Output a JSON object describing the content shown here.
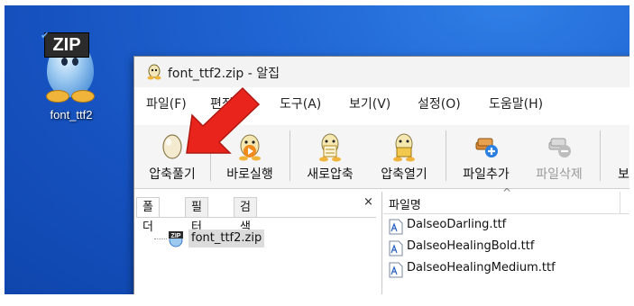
{
  "desktop": {
    "icon_badge": "ZIP",
    "icon_label": "font_ttf2"
  },
  "window": {
    "title": "font_ttf2.zip - 알집",
    "menu": [
      "파일(F)",
      "편집(E)",
      "도구(A)",
      "보기(V)",
      "설정(O)",
      "도움말(H)"
    ],
    "toolbar": [
      {
        "label": "압축풀기",
        "icon": "egg-icon",
        "enabled": true
      },
      {
        "label": "바로실행",
        "icon": "play-icon",
        "enabled": true
      },
      {
        "label": "새로압축",
        "icon": "new-archive-icon",
        "enabled": true
      },
      {
        "label": "압축열기",
        "icon": "open-archive-icon",
        "enabled": true
      },
      {
        "label": "파일추가",
        "icon": "add-file-icon",
        "enabled": true
      },
      {
        "label": "파일삭제",
        "icon": "delete-file-icon",
        "enabled": false
      },
      {
        "label": "보",
        "icon": "",
        "enabled": true
      }
    ],
    "left_tabs": [
      "폴더",
      "필터",
      "검색"
    ],
    "close_glyph": "×",
    "tree_item": "font_ttf2.zip",
    "column_header": "파일명",
    "sort_glyph": "^",
    "files": [
      "DalseoDarling.ttf",
      "DalseoHealingBold.ttf",
      "DalseoHealingMedium.ttf"
    ]
  },
  "colors": {
    "desktop_blue": "#1f64d2",
    "arrow_red": "#e8241c"
  }
}
